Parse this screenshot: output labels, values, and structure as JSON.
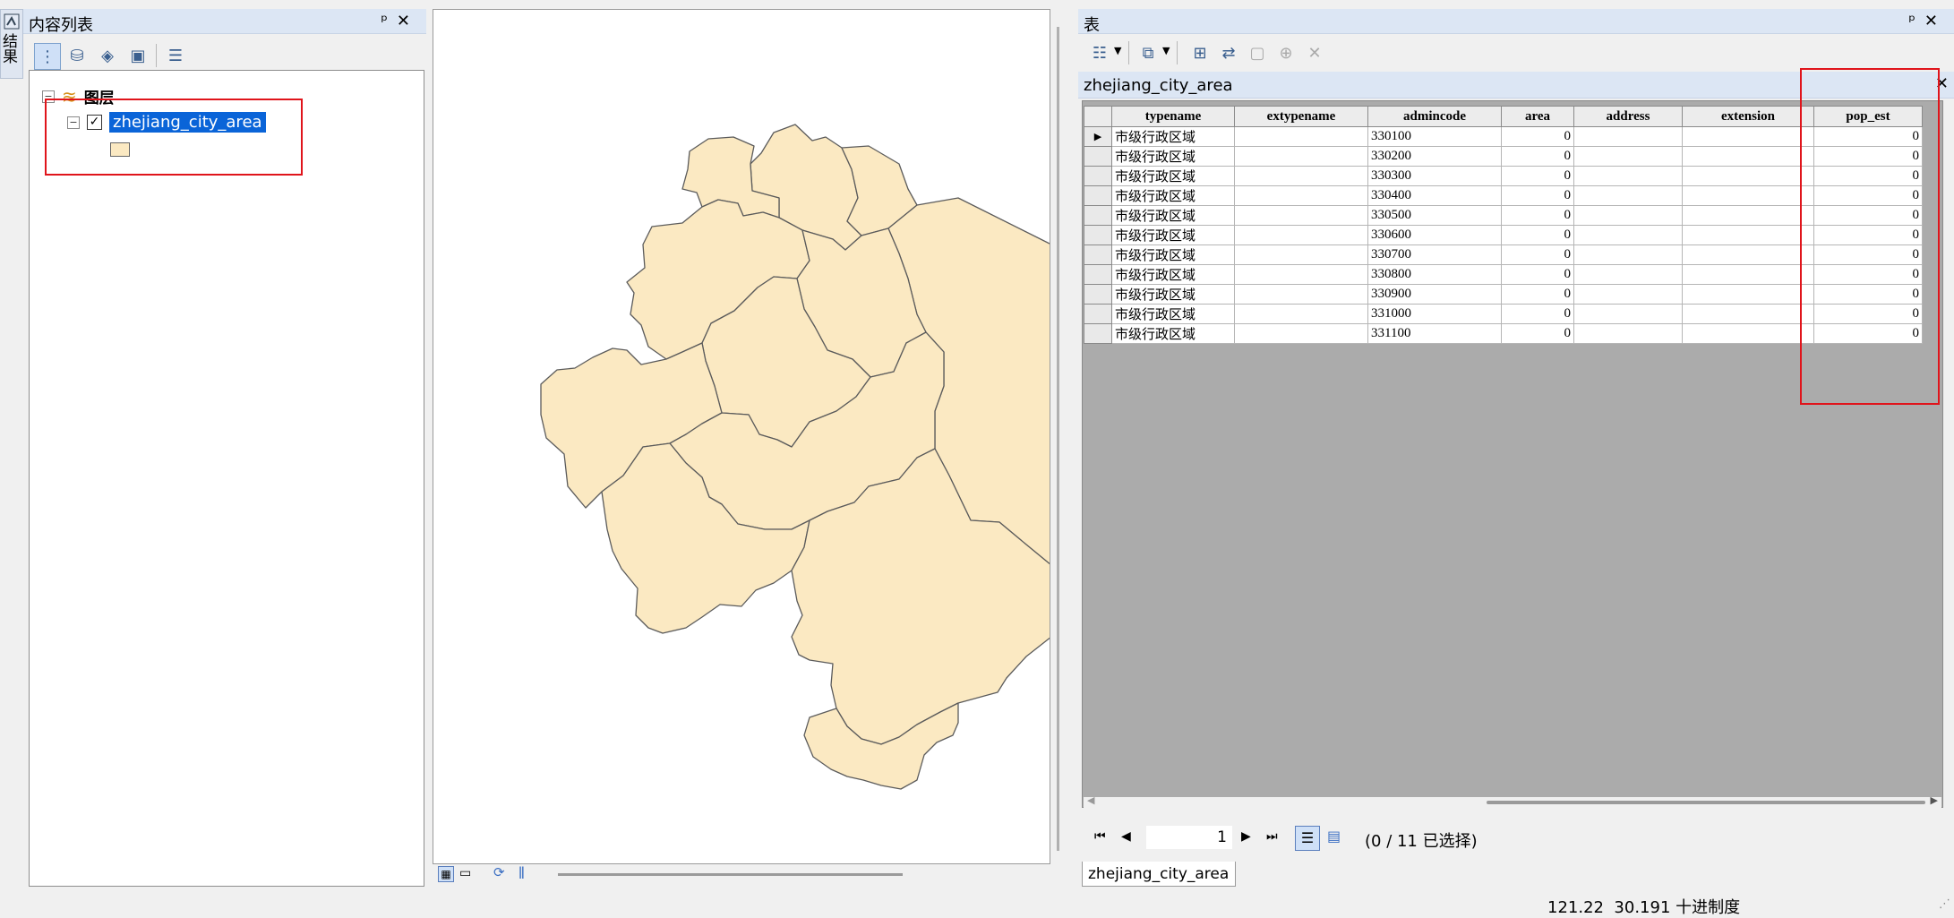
{
  "side_tab": {
    "label": "结果"
  },
  "toc": {
    "title": "内容列表",
    "root_label": "图层",
    "layer_name": "zhejiang_city_area",
    "toolbar": [
      "list-by-drawing-order-icon",
      "list-by-source-icon",
      "list-by-visibility-icon",
      "list-by-selection-icon",
      "options-icon"
    ]
  },
  "table_window": {
    "title": "表",
    "table_tab_title": "zhejiang_city_area",
    "bottom_tab": "zhejiang_city_area",
    "columns": [
      "typename",
      "extypename",
      "admincode",
      "area",
      "address",
      "extension",
      "pop_est"
    ],
    "rows": [
      [
        "市级行政区域",
        "",
        "330100",
        "0",
        "",
        "",
        "0"
      ],
      [
        "市级行政区域",
        "",
        "330200",
        "0",
        "",
        "",
        "0"
      ],
      [
        "市级行政区域",
        "",
        "330300",
        "0",
        "",
        "",
        "0"
      ],
      [
        "市级行政区域",
        "",
        "330400",
        "0",
        "",
        "",
        "0"
      ],
      [
        "市级行政区域",
        "",
        "330500",
        "0",
        "",
        "",
        "0"
      ],
      [
        "市级行政区域",
        "",
        "330600",
        "0",
        "",
        "",
        "0"
      ],
      [
        "市级行政区域",
        "",
        "330700",
        "0",
        "",
        "",
        "0"
      ],
      [
        "市级行政区域",
        "",
        "330800",
        "0",
        "",
        "",
        "0"
      ],
      [
        "市级行政区域",
        "",
        "330900",
        "0",
        "",
        "",
        "0"
      ],
      [
        "市级行政区域",
        "",
        "331000",
        "0",
        "",
        "",
        "0"
      ],
      [
        "市级行政区域",
        "",
        "331100",
        "0",
        "",
        "",
        "0"
      ]
    ],
    "current_record": "1",
    "selection_status": "(0 / 11 已选择)"
  },
  "status_bar": {
    "coords": "121.22  30.191 十进制度"
  },
  "colors": {
    "polygon_fill": "#fbe9c2",
    "selection": "#0a64d8",
    "highlight_box": "#e0141b"
  }
}
